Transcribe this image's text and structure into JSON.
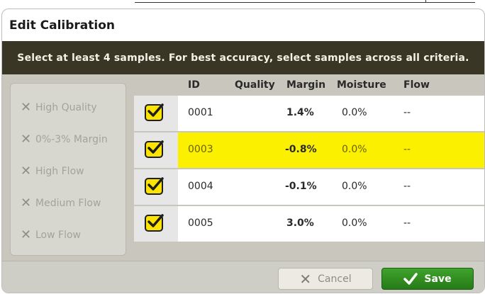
{
  "dialog": {
    "title": "Edit Calibration",
    "instructions": "Select at least 4 samples. For best accuracy, select samples across all criteria."
  },
  "criteria": [
    {
      "label": "High Quality",
      "icon": "x-icon"
    },
    {
      "label": "0%-3% Margin",
      "icon": "x-icon"
    },
    {
      "label": "High Flow",
      "icon": "x-icon"
    },
    {
      "label": "Medium Flow",
      "icon": "x-icon"
    },
    {
      "label": "Low Flow",
      "icon": "x-icon"
    }
  ],
  "table": {
    "columns": [
      "ID",
      "Quality",
      "Margin",
      "Moisture",
      "Flow"
    ],
    "rows": [
      {
        "checked": true,
        "id": "0001",
        "quality": "",
        "margin": "1.4%",
        "moisture": "0.0%",
        "flow": "--",
        "selected": false
      },
      {
        "checked": true,
        "id": "0003",
        "quality": "",
        "margin": "-0.8%",
        "moisture": "0.0%",
        "flow": "--",
        "selected": true
      },
      {
        "checked": true,
        "id": "0004",
        "quality": "",
        "margin": "-0.1%",
        "moisture": "0.0%",
        "flow": "--",
        "selected": false
      },
      {
        "checked": true,
        "id": "0005",
        "quality": "",
        "margin": "3.0%",
        "moisture": "0.0%",
        "flow": "--",
        "selected": false
      }
    ]
  },
  "footer": {
    "cancel_label": "Cancel",
    "save_label": "Save"
  },
  "colors": {
    "banner": "#3a3625",
    "highlight": "#fbf000",
    "checkbox": "#fde400",
    "save": "#2d8a1f"
  }
}
